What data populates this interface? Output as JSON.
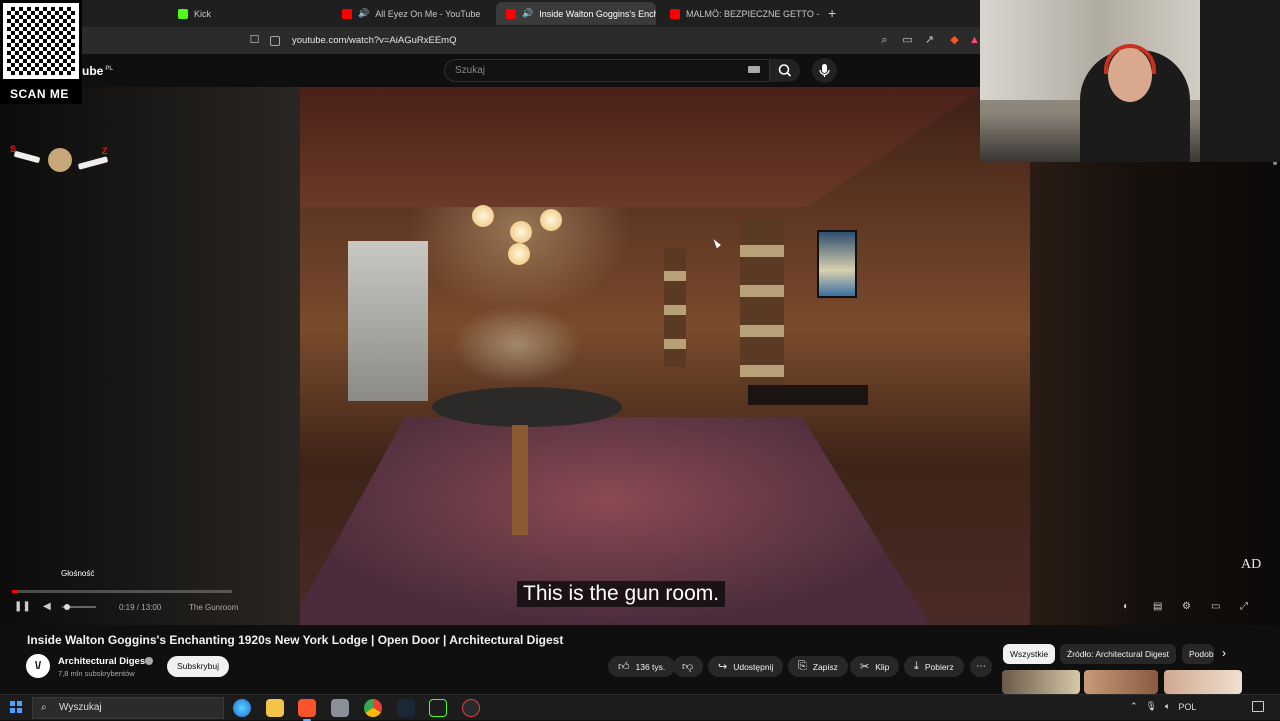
{
  "browser": {
    "tabs": [
      {
        "title": "Kick",
        "favicon_color": "#53fc18",
        "active": false
      },
      {
        "title": "All Eyez On Me - YouTube",
        "favicon_color": "#ff0000",
        "active": false,
        "audio": true
      },
      {
        "title": "Inside Walton Goggins's Ench",
        "favicon_color": "#ff0000",
        "active": true,
        "audio": true
      },
      {
        "title": "MALMÖ: BEZPIECZNE GETTO - YouTu",
        "favicon_color": "#ff0000",
        "active": false
      }
    ],
    "url": "youtube.com/watch?v=AiAGuRxEEmQ"
  },
  "youtube": {
    "logo_text": "ube",
    "country_code": "PL",
    "search_placeholder": "Szukaj"
  },
  "player": {
    "subtitle": "This is the gun room.",
    "watermark": "AD",
    "volume_tooltip": "Głośność",
    "time": "0:19 / 13:00",
    "chapter": "The Gunroom",
    "progress_fraction": 0.024
  },
  "video": {
    "title": "Inside Walton Goggins's Enchanting 1920s New York Lodge | Open Door | Architectural Digest",
    "channel_name": "Architectural Digest",
    "subscribers": "7,8 mln subskrybentów",
    "subscribe_label": "Subskrybuj",
    "likes": "136 tys.",
    "share_label": "Udostępnij",
    "save_label": "Zapisz",
    "clip_label": "Klip",
    "download_label": "Pobierz"
  },
  "chips": [
    "Wszystkie",
    "Źródło: Architectural Digest",
    "Podob"
  ],
  "overlay": {
    "qr_label": "SCAN ME"
  },
  "taskbar": {
    "search_placeholder": "Wyszukaj",
    "language": "POL"
  }
}
